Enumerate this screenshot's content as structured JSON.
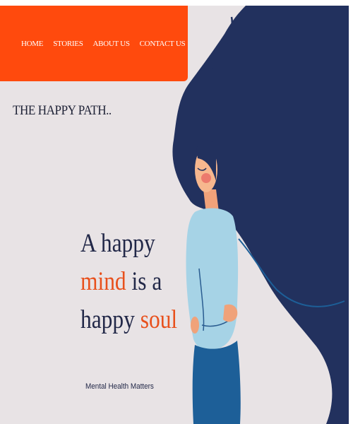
{
  "nav": {
    "items": [
      {
        "label": "HOME"
      },
      {
        "label": "STORIES"
      },
      {
        "label": "ABOUT US"
      },
      {
        "label": "CONTACT US"
      }
    ]
  },
  "brand": {
    "title": "THE HAPPY PATH.."
  },
  "hero": {
    "line1": "A happy",
    "line2_accent": "mind",
    "line2_rest": " is a",
    "line3_start": "happy ",
    "line3_accent": "soul",
    "tagline": "Mental Health Matters"
  },
  "colors": {
    "navbar": "#ff4a0d",
    "background": "#e8e3e5",
    "hair": "#22315e",
    "accent": "#e8501c",
    "text": "#222848",
    "sweater": "#a6d3e6",
    "pants": "#1d5f98"
  }
}
